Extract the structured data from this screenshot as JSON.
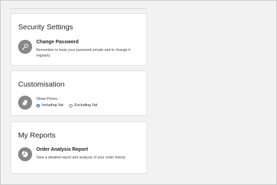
{
  "security": {
    "title": "Security Settings",
    "icon": "key-icon",
    "item_title": "Change Password",
    "item_desc": "Remember to keep your password private and to change it regularly"
  },
  "customisation": {
    "title": "Customisation",
    "icon": "price-tag-icon",
    "prices_label": "Show Prices :",
    "options": [
      {
        "label": "Including Vat",
        "selected": true
      },
      {
        "label": "Excluding Vat",
        "selected": false
      }
    ]
  },
  "reports": {
    "title": "My Reports",
    "icon": "pie-chart-icon",
    "item_title": "Order Analysis Report",
    "item_desc": "View a detailed report and analysis of your order history"
  },
  "colors": {
    "icon_circle": "#878787",
    "radio_selected": "#1a6fd8"
  }
}
